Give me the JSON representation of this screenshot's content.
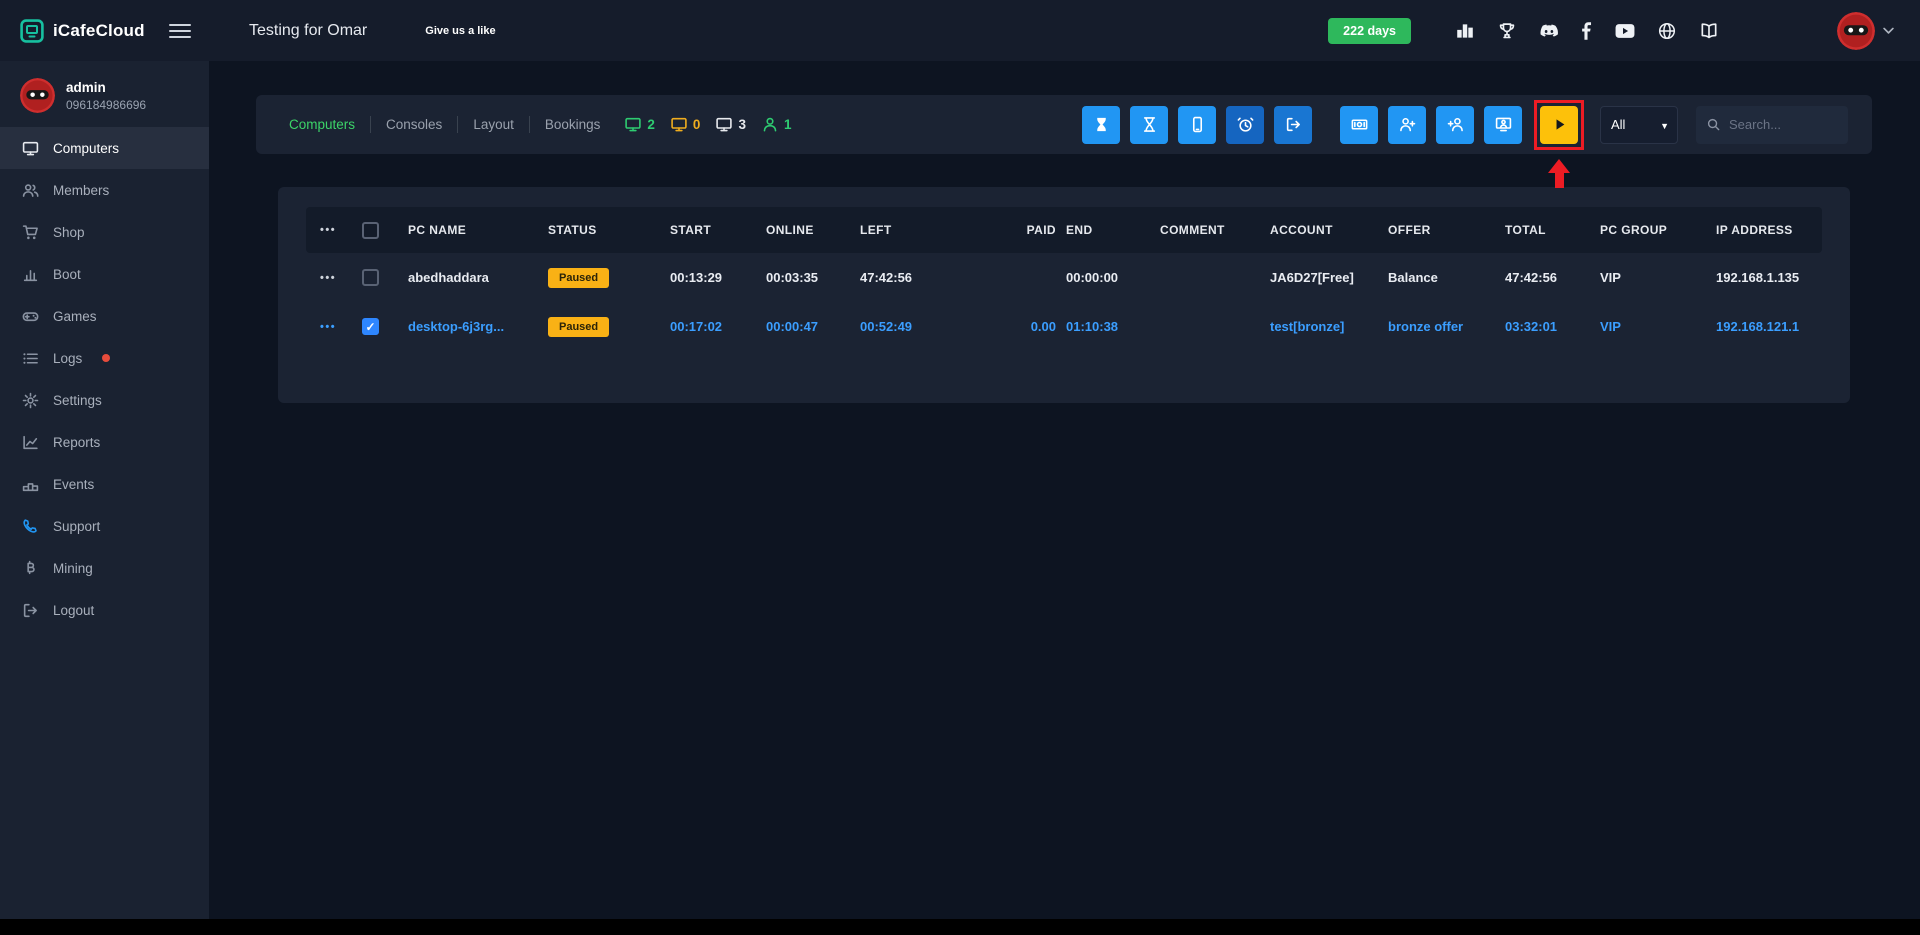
{
  "topbar": {
    "brand": "iCafeCloud",
    "title": "Testing for Omar",
    "like_label": "Give us a like",
    "days_badge": "222 days"
  },
  "sidebar": {
    "user_name": "admin",
    "user_phone": "096184986696",
    "items": [
      {
        "label": "Computers"
      },
      {
        "label": "Members"
      },
      {
        "label": "Shop"
      },
      {
        "label": "Boot"
      },
      {
        "label": "Games"
      },
      {
        "label": "Logs"
      },
      {
        "label": "Settings"
      },
      {
        "label": "Reports"
      },
      {
        "label": "Events"
      },
      {
        "label": "Support"
      },
      {
        "label": "Mining"
      },
      {
        "label": "Logout"
      }
    ]
  },
  "toolbar": {
    "tabs": [
      {
        "label": "Computers"
      },
      {
        "label": "Consoles"
      },
      {
        "label": "Layout"
      },
      {
        "label": "Bookings"
      }
    ],
    "counters": {
      "pcs_in_use": "2",
      "pcs_warning": "0",
      "pcs_total": "3",
      "members_online": "1"
    },
    "filter_value": "All",
    "search_placeholder": "Search..."
  },
  "table": {
    "headers": {
      "pc_name": "PC NAME",
      "status": "STATUS",
      "start": "START",
      "online": "ONLINE",
      "left": "LEFT",
      "paid": "PAID",
      "end": "END",
      "comment": "COMMENT",
      "account": "ACCOUNT",
      "offer": "OFFER",
      "total": "TOTAL",
      "pc_group": "PC GROUP",
      "ip_address": "IP ADDRESS"
    },
    "rows": [
      {
        "pc_name": "abedhaddara",
        "status": "Paused",
        "start": "00:13:29",
        "online": "00:03:35",
        "left": "47:42:56",
        "paid": "",
        "end": "00:00:00",
        "comment": "",
        "account": "JA6D27[Free]",
        "offer": "Balance",
        "total": "47:42:56",
        "pc_group": "VIP",
        "ip_address": "192.168.1.135"
      },
      {
        "pc_name": "desktop-6j3rg...",
        "status": "Paused",
        "start": "00:17:02",
        "online": "00:00:47",
        "left": "00:52:49",
        "paid": "0.00",
        "end": "01:10:38",
        "comment": "",
        "account": "test[bronze]",
        "offer": "bronze offer",
        "total": "03:32:01",
        "pc_group": "VIP",
        "ip_address": "192.168.121.1"
      }
    ]
  },
  "icons": {
    "more_actions": "•••",
    "check": "✓",
    "caret_down": "▼"
  },
  "colors": {
    "accent_green": "#2eb85c",
    "accent_blue": "#2196f3",
    "accent_yellow": "#fdc10a",
    "link_blue": "#3b9eff",
    "annotation_red": "#ed1c24"
  }
}
